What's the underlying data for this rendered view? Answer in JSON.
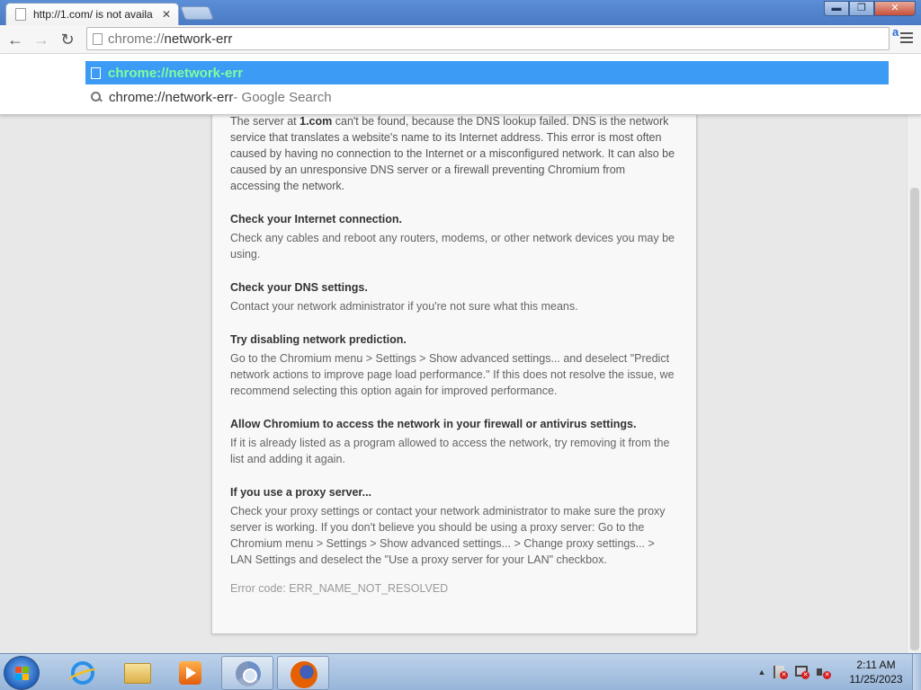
{
  "browser": {
    "tab": {
      "title": "http://1.com/ is not availa",
      "close_glyph": "✕"
    },
    "window_buttons": {
      "minimize": "▬",
      "maximize": "❐",
      "close": "✕"
    },
    "toolbar": {
      "back_glyph": "←",
      "forward_glyph": "→",
      "reload_glyph": "↻",
      "url_scheme": "chrome://",
      "url_rest": "network-err",
      "extension_glyph": "a"
    },
    "dropdown": {
      "selected": "chrome://network-err",
      "search_query": "chrome://network-err",
      "search_desc": " - Google Search"
    }
  },
  "page": {
    "intro_pre": "The server at ",
    "intro_host": "1.com",
    "intro_post": " can't be found, because the DNS lookup failed. DNS is the network service that translates a website's name to its Internet address. This error is most often caused by having no connection to the Internet or a misconfigured network. It can also be caused by an unresponsive DNS server or a firewall preventing Chromium from accessing the network.",
    "sections": [
      {
        "heading": "Check your Internet connection.",
        "body": "Check any cables and reboot any routers, modems, or other network devices you may be using."
      },
      {
        "heading": "Check your DNS settings.",
        "body": "Contact your network administrator if you're not sure what this means."
      },
      {
        "heading": "Try disabling network prediction.",
        "body": "Go to the Chromium menu > Settings > Show advanced settings... and deselect \"Predict network actions to improve page load performance.\" If this does not resolve the issue, we recommend selecting this option again for improved performance."
      },
      {
        "heading": "Allow Chromium to access the network in your firewall or antivirus settings.",
        "body": "If it is already listed as a program allowed to access the network, try removing it from the list and adding it again."
      },
      {
        "heading": "If you use a proxy server...",
        "body": "Check your proxy settings or contact your network administrator to make sure the proxy server is working. If you don't believe you should be using a proxy server: Go to the Chromium menu > Settings > Show advanced settings... > Change proxy settings... > LAN Settings and deselect the \"Use a proxy server for your LAN\" checkbox."
      }
    ],
    "error_code": "Error code: ERR_NAME_NOT_RESOLVED"
  },
  "taskbar": {
    "tray_arrow": "▲",
    "time": "2:11 AM",
    "date": "11/25/2023"
  },
  "colors": {
    "selected_suggestion_bg": "#3b9bf5",
    "selected_suggestion_text": "#7dff9c"
  }
}
